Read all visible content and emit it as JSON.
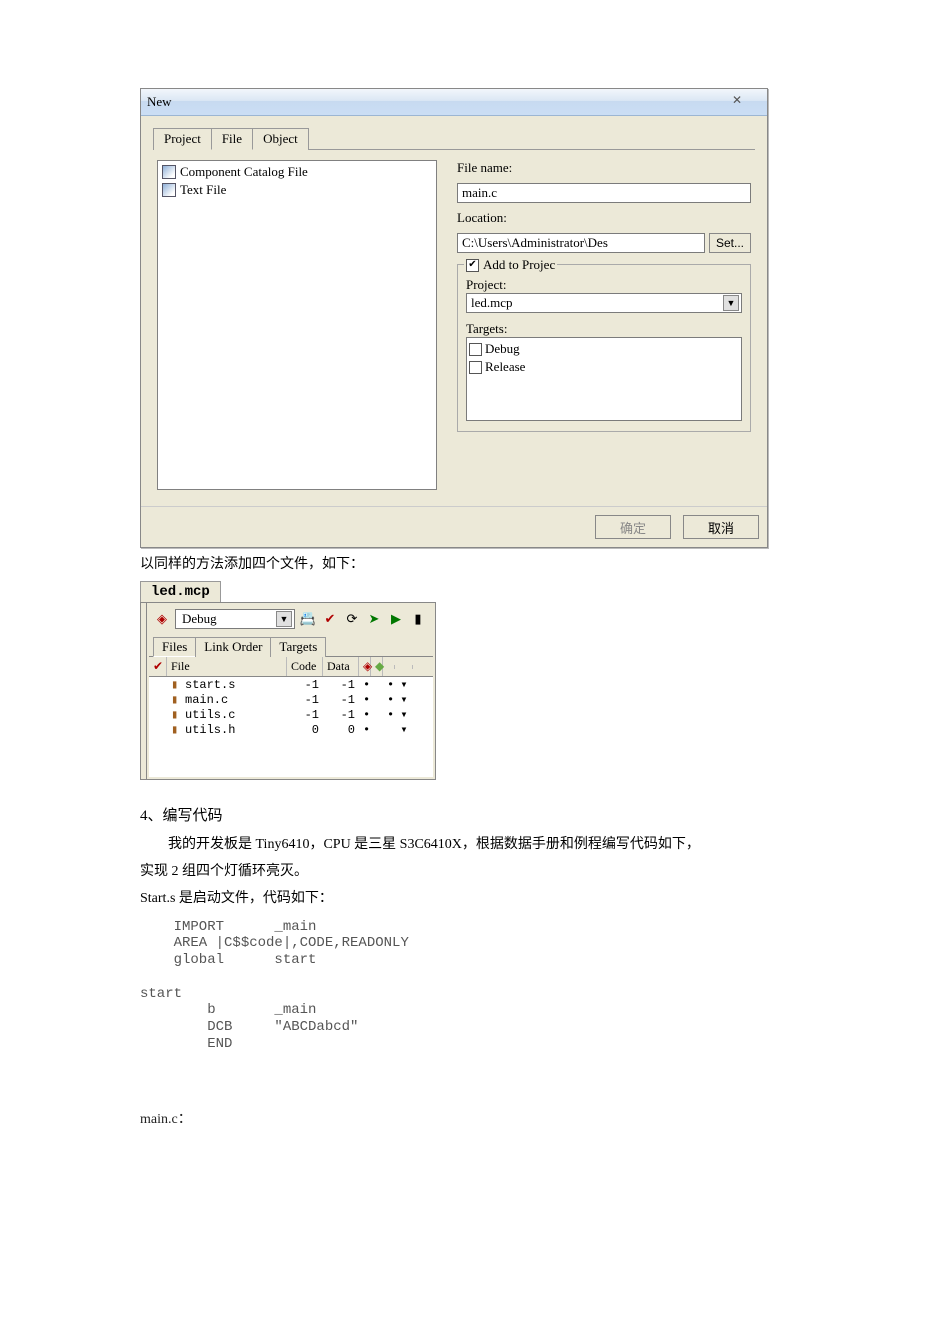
{
  "dialog": {
    "title": "New",
    "close_label": "✕",
    "tabs": [
      "Project",
      "File",
      "Object"
    ],
    "active_tab": 1,
    "filetypes": [
      {
        "label": "Component Catalog File"
      },
      {
        "label": "Text File"
      }
    ],
    "filename_label": "File name:",
    "filename_value": "main.c",
    "location_label": "Location:",
    "location_value": "C:\\Users\\Administrator\\Des",
    "set_button": "Set...",
    "add_to_project_label": "Add to Projec",
    "add_to_project_checked": true,
    "project_label": "Project:",
    "project_value": "led.mcp",
    "targets_label": "Targets:",
    "targets": [
      {
        "label": "Debug",
        "checked": false
      },
      {
        "label": "Release",
        "checked": false
      }
    ],
    "ok_button": "确定",
    "cancel_button": "取消"
  },
  "between_text": "以同样的方法添加四个文件，如下：",
  "project": {
    "tab_name": "led.mcp",
    "target": "Debug",
    "subtabs": [
      "Files",
      "Link Order",
      "Targets"
    ],
    "active_subtab": 0,
    "columns": {
      "check": "✔",
      "file": "File",
      "code": "Code",
      "data": "Data"
    },
    "rows": [
      {
        "name": "start.s",
        "code": "-1",
        "data": "-1",
        "d1": "•",
        "d2": "•",
        "arrow": "▾"
      },
      {
        "name": "main.c",
        "code": "-1",
        "data": "-1",
        "d1": "•",
        "d2": "•",
        "arrow": "▾"
      },
      {
        "name": "utils.c",
        "code": "-1",
        "data": "-1",
        "d1": "•",
        "d2": "•",
        "arrow": "▾"
      },
      {
        "name": "utils.h",
        "code": "0",
        "data": "0",
        "d1": "•",
        "d2": "",
        "arrow": "▾"
      }
    ]
  },
  "section4_title": "4、编写代码",
  "section4_line1": "　　我的开发板是 Tiny6410，CPU 是三星 S3C6410X，根据数据手册和例程编写代码如下，",
  "section4_line2": "实现 2 组四个灯循环亮灭。",
  "section4_line3": "Start.s 是启动文件，代码如下：",
  "code_start_s": "    IMPORT      _main\n    AREA |C$$code|,CODE,READONLY\n    global      start\n\nstart\n        b       _main\n        DCB     \"ABCDabcd\"\n        END",
  "mainc_label": "main.c："
}
